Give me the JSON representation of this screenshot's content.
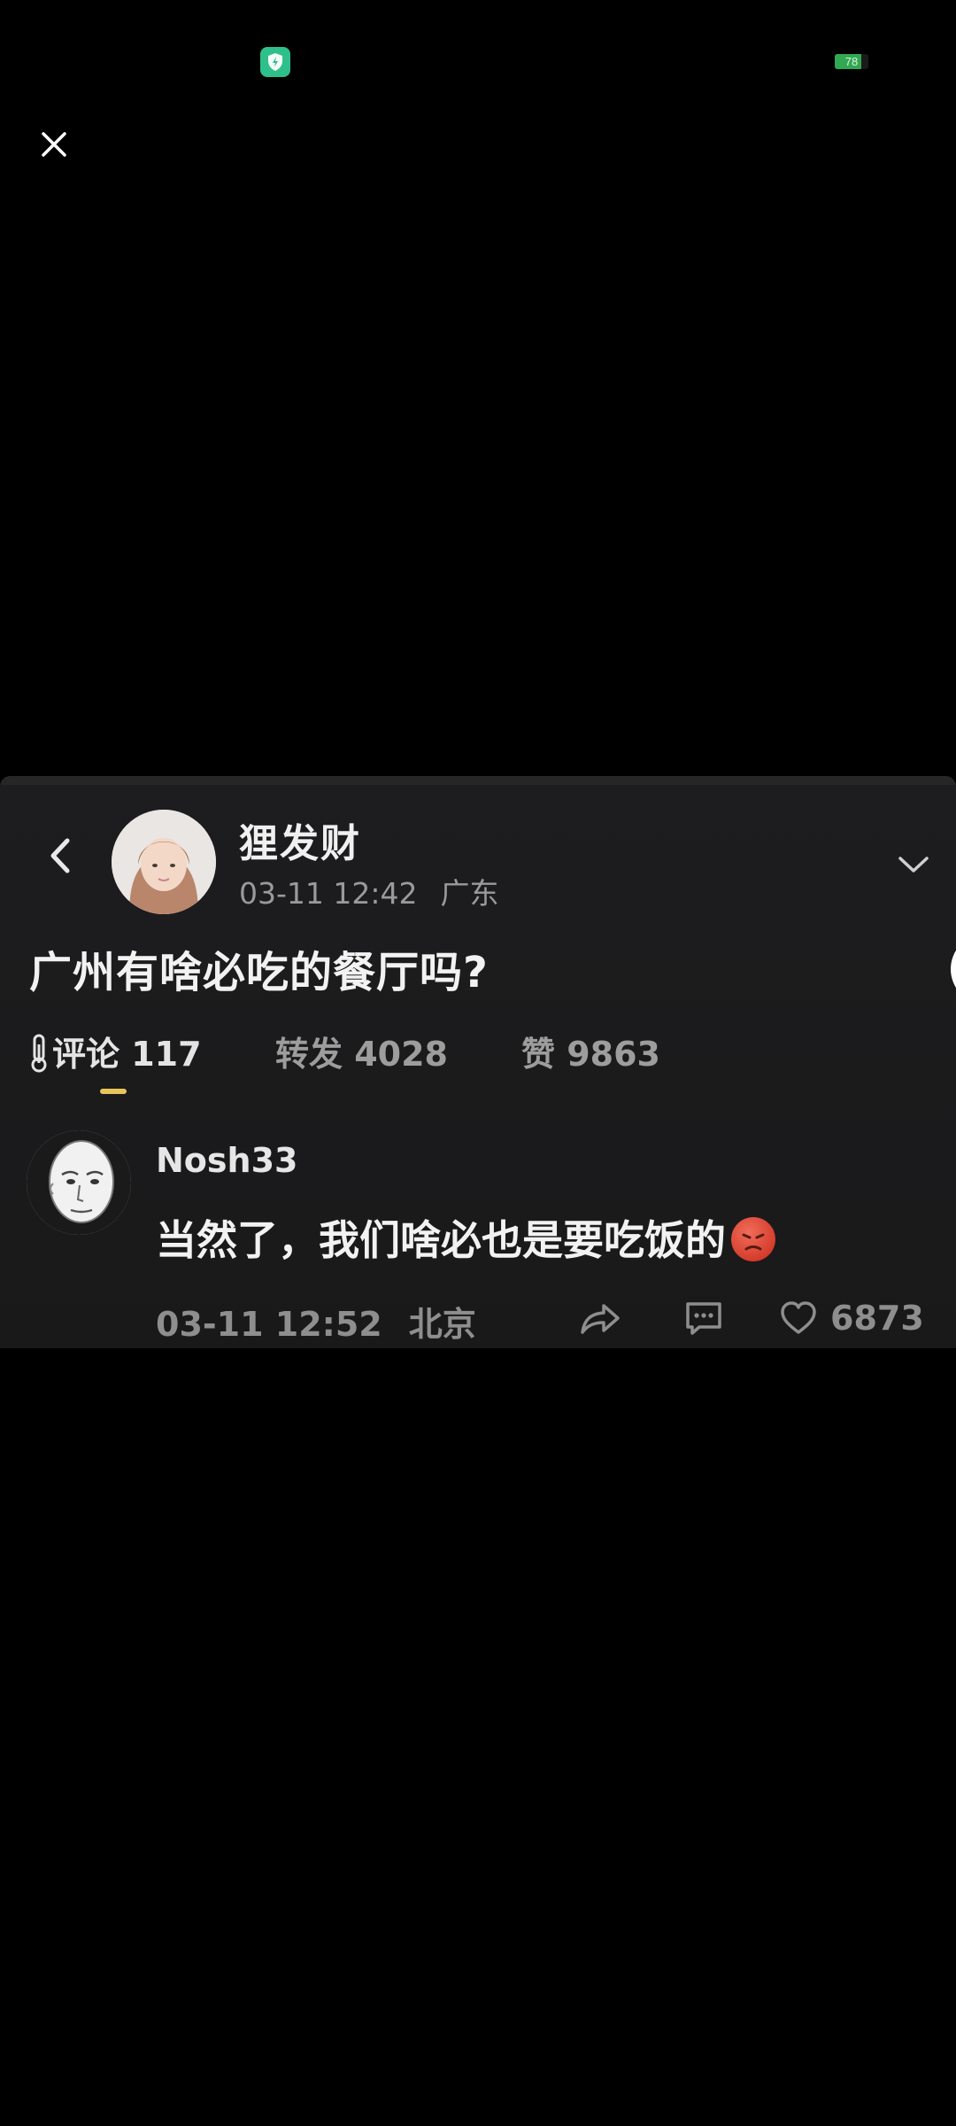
{
  "status_bar": {
    "battery_level": 78,
    "battery_text": "78",
    "accent_color": "#2fbf8a",
    "icons": [
      "shield-icon",
      "battery-icon"
    ]
  },
  "viewer": {
    "close_icon": "close-icon"
  },
  "post": {
    "author": "狸发财",
    "date": "03-11 12:42",
    "location": "广东",
    "text": "广州有啥必吃的餐厅吗?",
    "tabs": {
      "comments_label": "评论 117",
      "reposts_label": "转发 4028",
      "likes_label": "赞 9863"
    }
  },
  "comment": {
    "author": "Nosh33",
    "text": "当然了，我们啥必也是要吃饭的",
    "date": "03-11 12:52",
    "location": "北京",
    "like_count": "6873"
  }
}
